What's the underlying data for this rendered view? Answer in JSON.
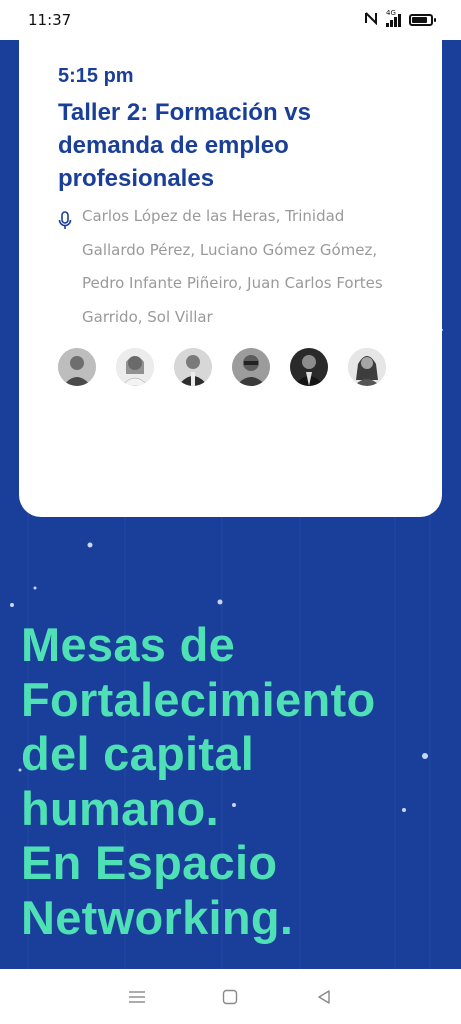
{
  "status_bar": {
    "time": "11:37",
    "network": "4G",
    "battery_level": 0.85
  },
  "session": {
    "time": "5:15 pm",
    "title": "Taller 2: Formación vs demanda de empleo profesionales",
    "speakers": "Carlos López de las Heras, Trinidad Gallardo Pérez, Luciano Gómez Gómez, Pedro Infante Piñeiro, Juan Carlos Fortes Garrido, Sol Villar",
    "avatars": [
      {
        "icon": "person-photo"
      },
      {
        "icon": "person-photo"
      },
      {
        "icon": "person-photo"
      },
      {
        "icon": "person-photo"
      },
      {
        "icon": "person-photo"
      },
      {
        "icon": "person-photo"
      }
    ]
  },
  "headline": {
    "line1": "Mesas de",
    "line2": "Fortalecimiento",
    "line3": "del capital",
    "line4": "humano.",
    "line5": "En Espacio",
    "line6": "Networking."
  },
  "colors": {
    "brand_blue": "#1a3f9a",
    "accent_green": "#4fe0b5",
    "muted_text": "#9a9a9a"
  }
}
